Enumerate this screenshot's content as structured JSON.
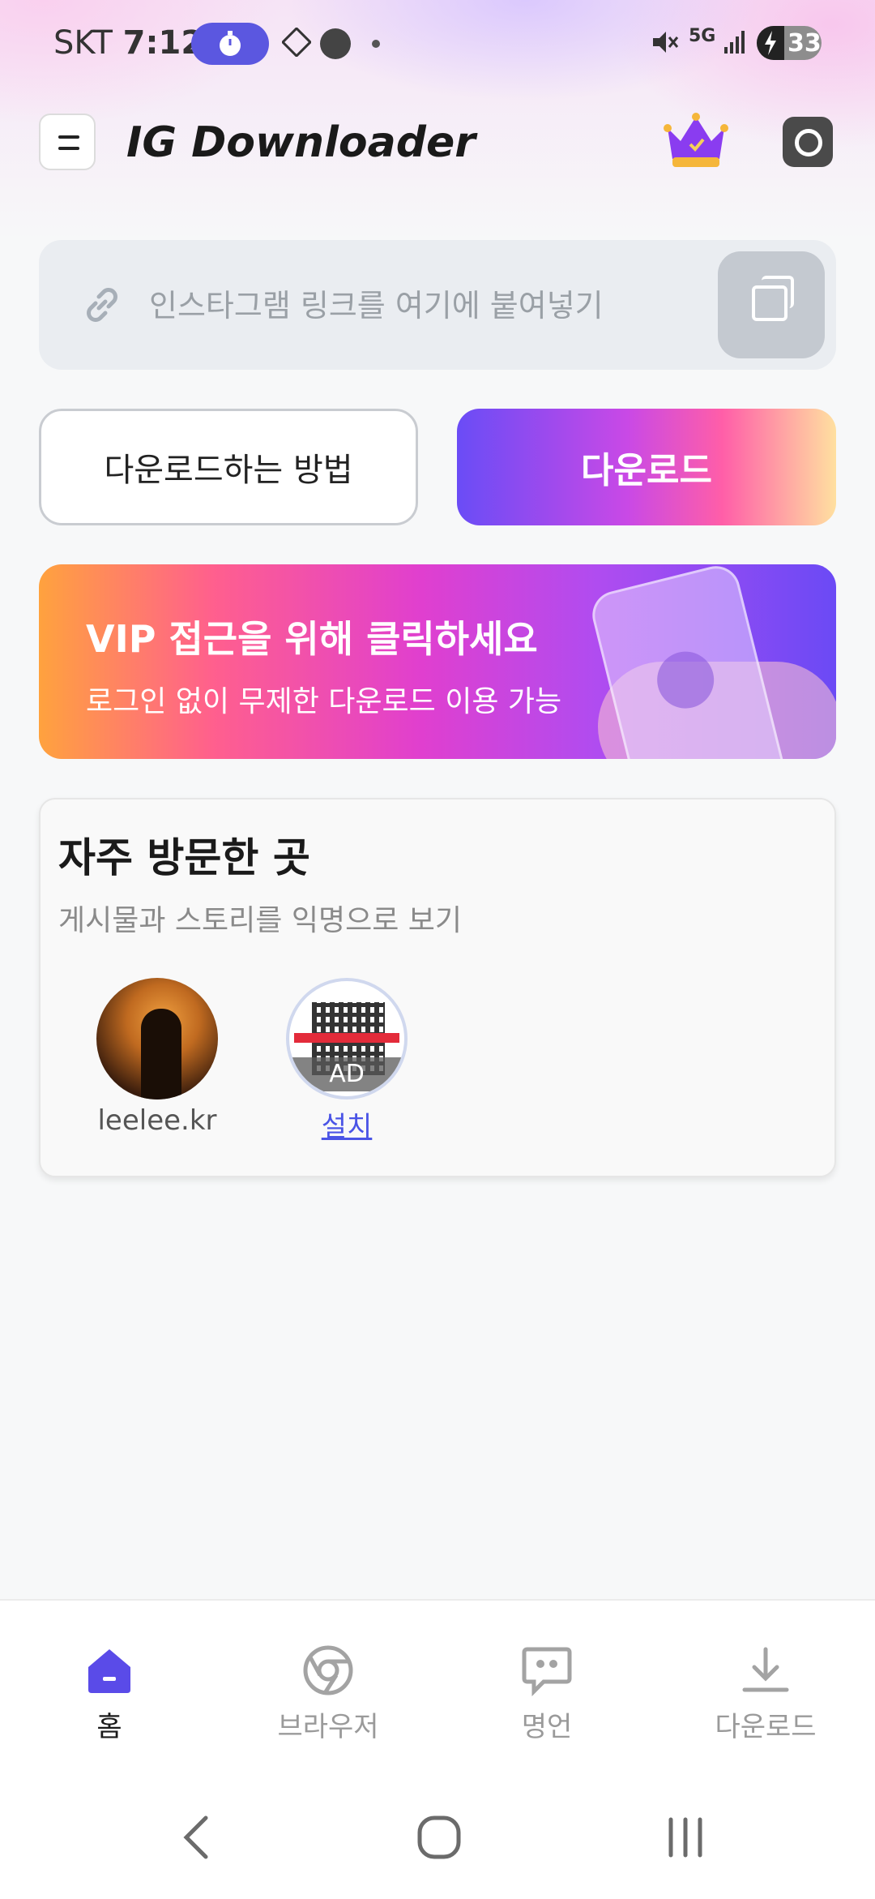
{
  "status_bar": {
    "carrier": "SKT",
    "time": "7:12",
    "battery": "33",
    "network": "5G"
  },
  "header": {
    "app_title": "IG Downloader"
  },
  "link_input": {
    "placeholder": "인스타그램 링크를 여기에 붙여넣기"
  },
  "actions": {
    "howto_label": "다운로드하는 방법",
    "download_label": "다운로드"
  },
  "vip_banner": {
    "title": "VIP 접근을 위해 클릭하세요",
    "subtitle": "로그인 없이 무제한 다운로드 이용 가능"
  },
  "frequent": {
    "title": "자주 방문한 곳",
    "subtitle": "게시물과 스토리를 익명으로 보기",
    "items": [
      {
        "label": "leelee.kr"
      },
      {
        "label": "설치",
        "badge": "AD"
      }
    ]
  },
  "bottom_nav": {
    "items": [
      {
        "label": "홈",
        "icon": "home-icon",
        "active": true
      },
      {
        "label": "브라우저",
        "icon": "browser-icon"
      },
      {
        "label": "명언",
        "icon": "quote-icon"
      },
      {
        "label": "다운로드",
        "icon": "download-icon"
      }
    ]
  },
  "colors": {
    "accent": "#5b57e0",
    "download_gradient_start": "#6a4cf6",
    "download_gradient_end": "#ffe0a0"
  }
}
